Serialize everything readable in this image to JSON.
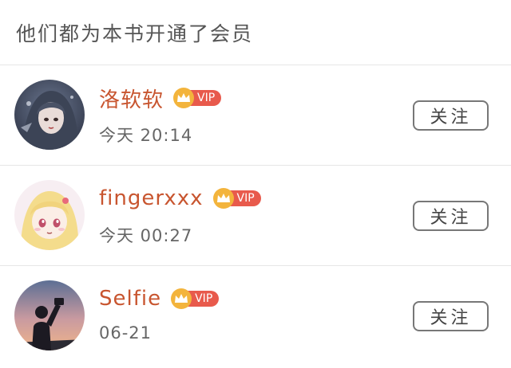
{
  "header": {
    "title": "他们都为本书开通了会员"
  },
  "colors": {
    "username": "#c8552f",
    "vip_badge": "#e85a4c",
    "crown": "#f3b43c",
    "divider": "#e6e6e6"
  },
  "members": [
    {
      "name": "洛软软",
      "badge": "VIP",
      "time": "今天 20:14",
      "follow_label": "关注",
      "avatar_icon": "avatar-anime-girl-dark"
    },
    {
      "name": "fingerxxx",
      "badge": "VIP",
      "time": "今天 00:27",
      "follow_label": "关注",
      "avatar_icon": "avatar-anime-girl-blonde"
    },
    {
      "name": "Selfie",
      "badge": "VIP",
      "time": "06-21",
      "follow_label": "关注",
      "avatar_icon": "avatar-silhouette-sunset"
    }
  ]
}
